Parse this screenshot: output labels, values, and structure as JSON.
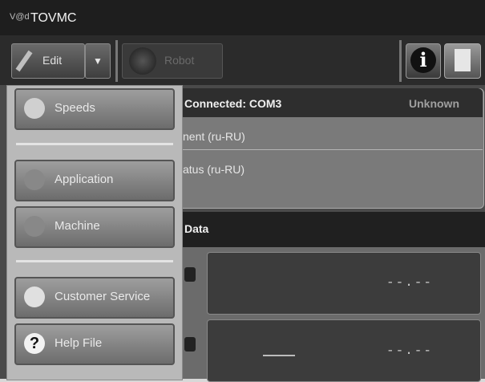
{
  "window": {
    "title": "TOVMC",
    "logo_text": "V@d"
  },
  "toolbar": {
    "edit_label": "Edit",
    "dropdown_glyph": "▼",
    "robot_label": "Robot",
    "info_glyph": "i"
  },
  "menu": {
    "items": [
      {
        "label": "Speeds",
        "icon": "speeds-icon"
      },
      {
        "label": "Application",
        "icon": "application-icon"
      },
      {
        "label": "Machine",
        "icon": "machine-icon"
      },
      {
        "label": "Customer Service",
        "icon": "customer-service-icon"
      },
      {
        "label": "Help File",
        "icon": "help-icon",
        "glyph": "?"
      }
    ]
  },
  "connection": {
    "title": "Connected: COM3",
    "status": "Unknown",
    "line1": "nent (ru-RU)",
    "line2": "atus (ru-RU)"
  },
  "data_panel": {
    "title": "Data",
    "value1": "--.--",
    "value2": "--.--"
  },
  "colors": {
    "header_bg": "#2e2e2e",
    "panel_bg": "#7a7a7a",
    "menu_bg": "#b9b9b9"
  }
}
